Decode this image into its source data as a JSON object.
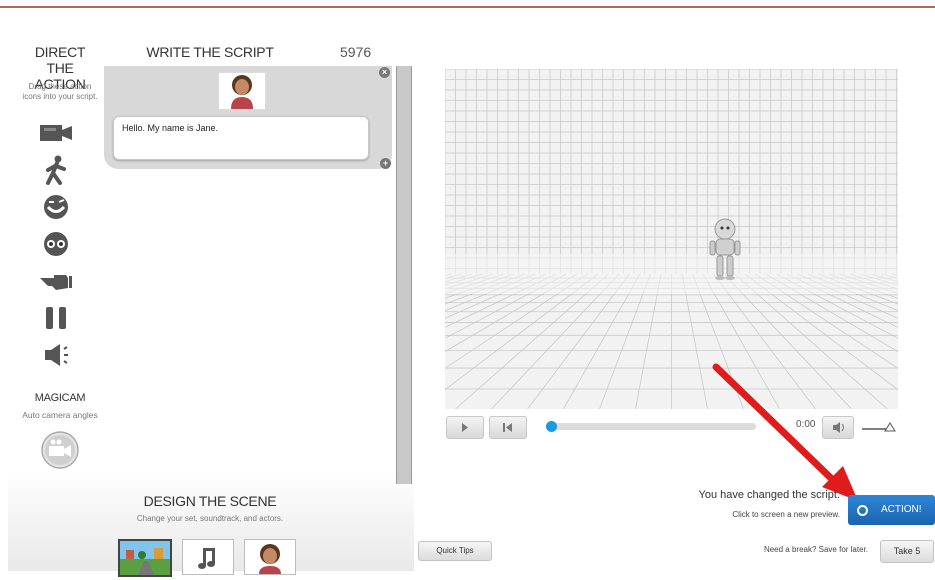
{
  "direct": {
    "title_line1": "DIRECT",
    "title_line2": "THE ACTION",
    "subtitle_line1": "Drag these action",
    "subtitle_line2": "icons into your script."
  },
  "action_icons": [
    "camera-icon",
    "walk-icon",
    "expression-icon",
    "eyes-icon",
    "gesture-icon",
    "pause-icon",
    "sound-icon"
  ],
  "magicam": {
    "title": "MAGICAM",
    "subtitle": "Auto camera angles"
  },
  "script": {
    "title": "WRITE THE SCRIPT",
    "char_count": "5976",
    "line_text": "Hello.  My name is Jane."
  },
  "player": {
    "time": "0:00",
    "progress": 0.0
  },
  "status": {
    "changed_msg": "You have changed the script.",
    "preview_msg": "Click to screen a new preview.",
    "action_label": "ACTION!",
    "break_msg": "Need a break? Save for later.",
    "take5_label": "Take 5",
    "quick_tips_label": "Quick Tips"
  },
  "design": {
    "title": "DESIGN THE SCENE",
    "subtitle": "Change your set, soundtrack, and actors."
  },
  "colors": {
    "accent": "#1a98e0",
    "action_button": "#1f6fc0",
    "arrow": "#e01b1b",
    "top_line": "#b9664e"
  }
}
